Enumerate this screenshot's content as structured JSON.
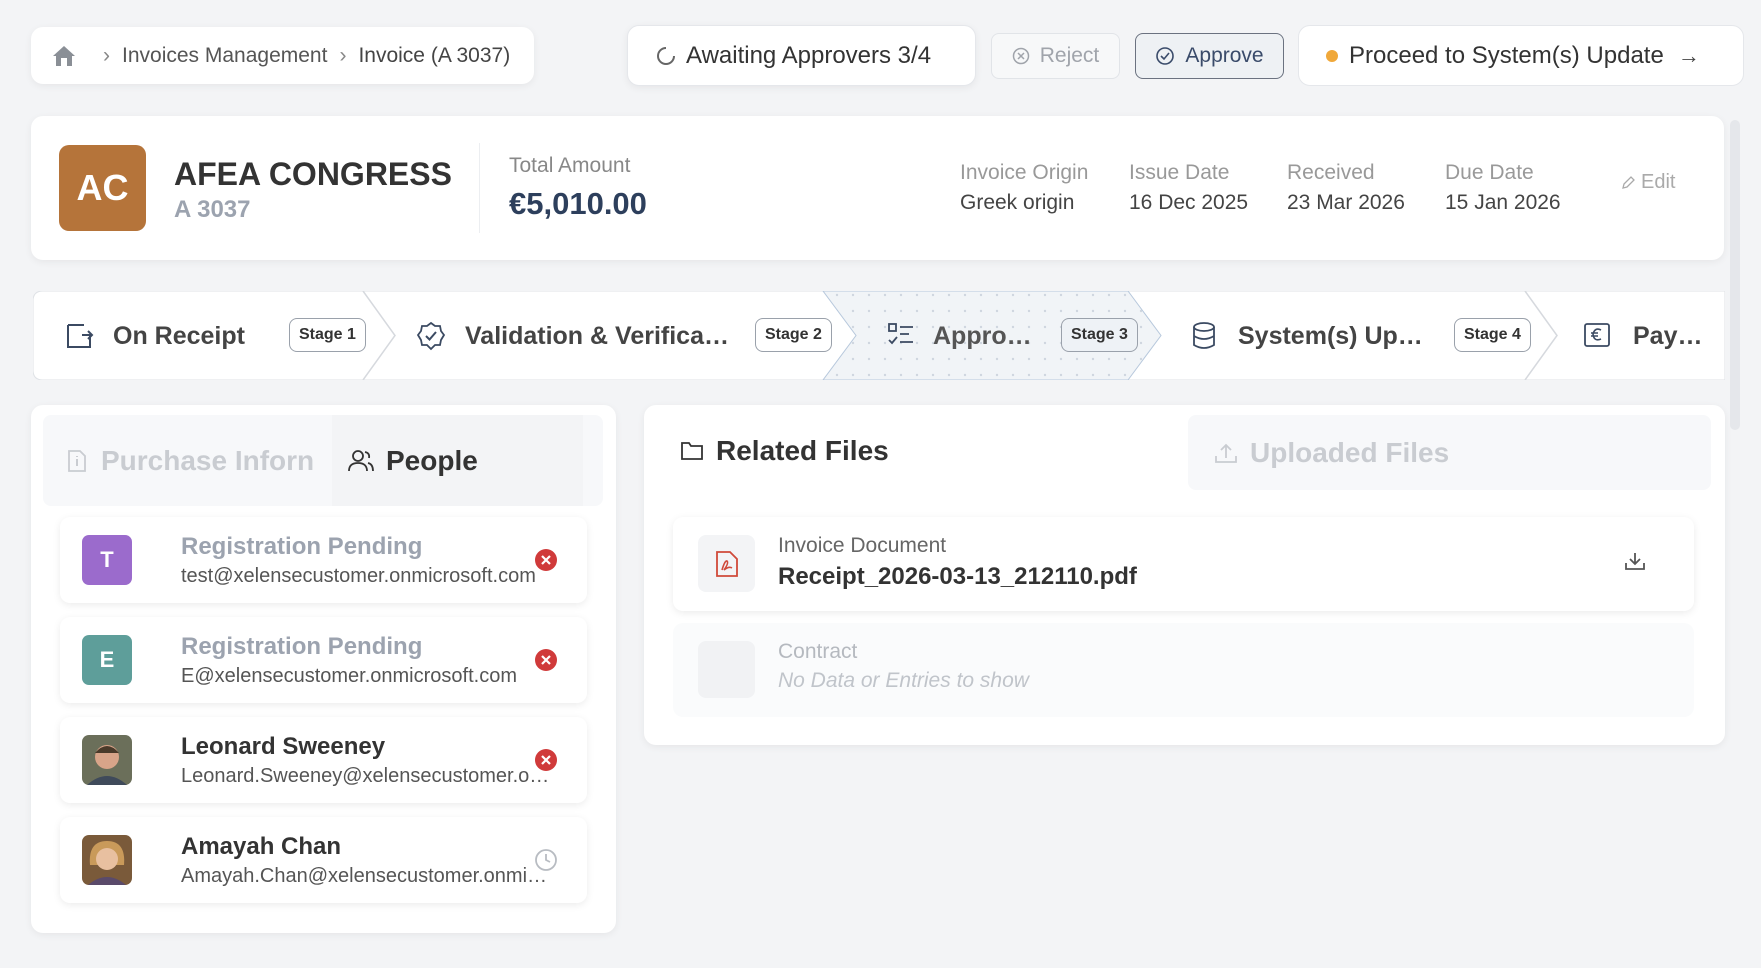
{
  "breadcrumb": {
    "section": "Invoices Management",
    "current": "Invoice (A 3037)"
  },
  "status": {
    "label": "Awaiting Approvers 3/4"
  },
  "actions": {
    "reject": "Reject",
    "approve": "Approve",
    "proceed": "Proceed to System(s) Update"
  },
  "header": {
    "initials": "AC",
    "company": "AFEA CONGRESS",
    "code": "A 3037",
    "total_label": "Total Amount",
    "total": "€5,010.00",
    "meta": [
      {
        "label": "Invoice Origin",
        "value": "Greek origin"
      },
      {
        "label": "Issue Date",
        "value": "16 Dec 2025"
      },
      {
        "label": "Received",
        "value": "23 Mar 2026"
      },
      {
        "label": "Due Date",
        "value": "15 Jan 2026"
      }
    ],
    "edit": "Edit",
    "accent": "#b5743a"
  },
  "stages": [
    {
      "label": "On Receipt",
      "badge": "Stage 1",
      "icon": "inbox-icon"
    },
    {
      "label": "Validation & Verifica…",
      "badge": "Stage 2",
      "icon": "check-badge-icon"
    },
    {
      "label": "Appro…",
      "badge": "Stage 3",
      "icon": "checklist-icon",
      "active": true
    },
    {
      "label": "System(s) Up…",
      "badge": "Stage 4",
      "icon": "database-icon"
    },
    {
      "label": "Pay…",
      "badge": "",
      "icon": "euro-icon"
    }
  ],
  "left_tabs": {
    "purchase": "Purchase Inforn",
    "people": "People"
  },
  "people": [
    {
      "initial": "T",
      "name": "Registration Pending",
      "email": "test@xelensecustomer.onmicrosoft.com",
      "status": "rejected",
      "color": "#9b6bcc"
    },
    {
      "initial": "E",
      "name": "Registration Pending",
      "email": "E@xelensecustomer.onmicrosoft.com",
      "status": "rejected",
      "color": "#5e9e9a"
    },
    {
      "initial": "",
      "name": "Leonard Sweeney",
      "email": "Leonard.Sweeney@xelensecustomer.onmicrosoft.com",
      "status": "rejected",
      "color": ""
    },
    {
      "initial": "",
      "name": "Amayah Chan",
      "email": "Amayah.Chan@xelensecustomer.onmicrosoft.com",
      "status": "pending",
      "color": ""
    }
  ],
  "right_tabs": {
    "related": "Related Files",
    "uploaded": "Uploaded Files"
  },
  "files": {
    "invoice_label": "Invoice Document",
    "invoice_name": "Receipt_2026-03-13_212110.pdf",
    "contract_label": "Contract",
    "contract_empty": "No Data or Entries to show"
  }
}
